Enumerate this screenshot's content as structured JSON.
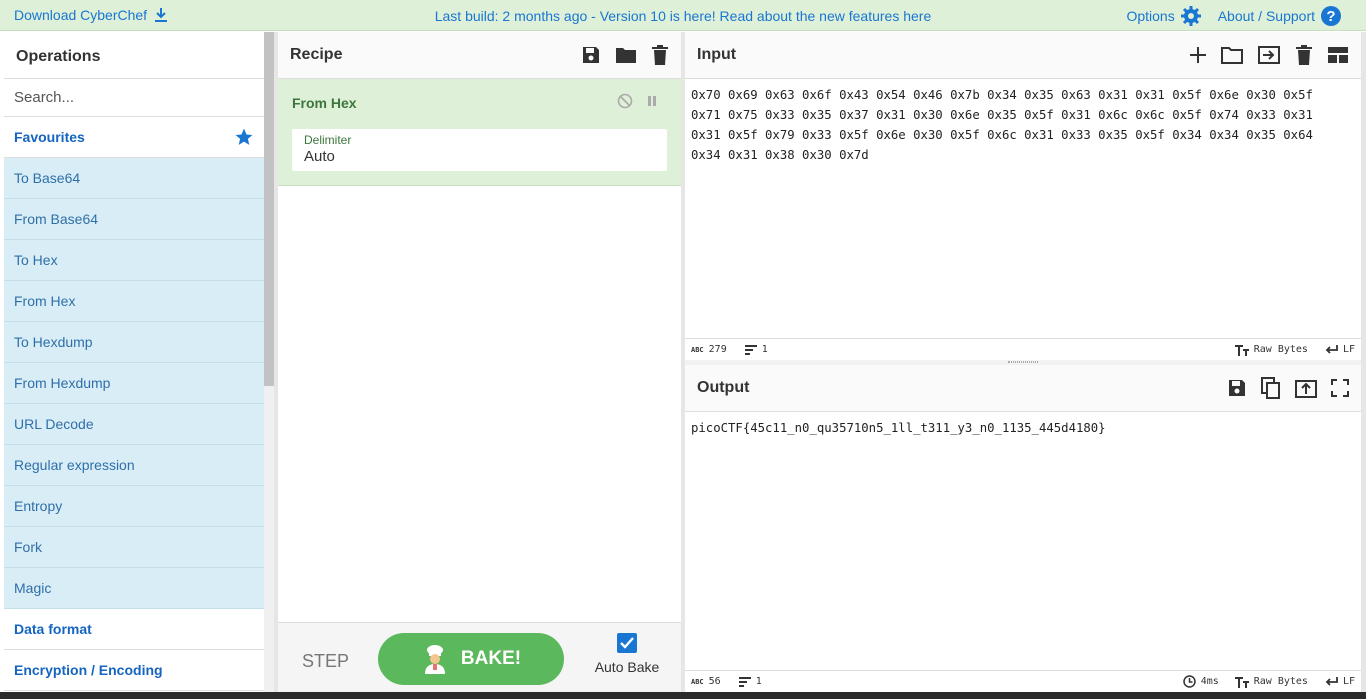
{
  "banner": {
    "download_label": "Download CyberChef",
    "build_text": "Last build: 2 months ago - Version 10 is here! Read about the new features here",
    "options_label": "Options",
    "about_label": "About / Support"
  },
  "operations": {
    "title": "Operations",
    "search_placeholder": "Search...",
    "favourites_label": "Favourites",
    "items": [
      "To Base64",
      "From Base64",
      "To Hex",
      "From Hex",
      "To Hexdump",
      "From Hexdump",
      "URL Decode",
      "Regular expression",
      "Entropy",
      "Fork",
      "Magic"
    ],
    "categories": [
      "Data format",
      "Encryption / Encoding"
    ]
  },
  "recipe": {
    "title": "Recipe",
    "op_name": "From Hex",
    "arg_label": "Delimiter",
    "arg_value": "Auto",
    "step_label": "STEP",
    "bake_label": "BAKE!",
    "autobake_label": "Auto Bake"
  },
  "input": {
    "title": "Input",
    "text": "0x70 0x69 0x63 0x6f 0x43 0x54 0x46 0x7b 0x34 0x35 0x63 0x31 0x31 0x5f 0x6e 0x30 0x5f\n0x71 0x75 0x33 0x35 0x37 0x31 0x30 0x6e 0x35 0x5f 0x31 0x6c 0x6c 0x5f 0x74 0x33 0x31\n0x31 0x5f 0x79 0x33 0x5f 0x6e 0x30 0x5f 0x6c 0x31 0x33 0x35 0x5f 0x34 0x34 0x35 0x64\n0x34 0x31 0x38 0x30 0x7d",
    "char_count": "279",
    "line_count": "1",
    "encoding": "Raw Bytes",
    "eol": "LF"
  },
  "output": {
    "title": "Output",
    "text": "picoCTF{45c11_n0_qu35710n5_1ll_t311_y3_n0_1135_445d4180}",
    "char_count": "56",
    "line_count": "1",
    "time": "4ms",
    "encoding": "Raw Bytes",
    "eol": "LF"
  },
  "colors": {
    "banner_bg": "#dff0d8",
    "link_blue": "#1976d2",
    "op_bg": "#d9edf7",
    "bake_green": "#5cb85c",
    "recipe_green": "#3c763d"
  }
}
